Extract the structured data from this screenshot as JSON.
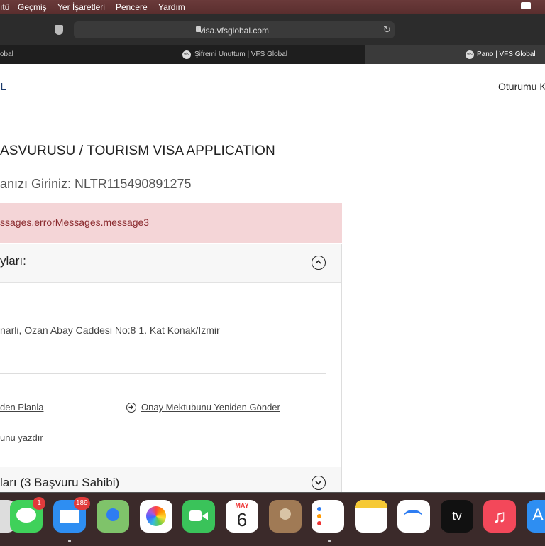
{
  "menubar": {
    "items": [
      "ıtü",
      "Geçmiş",
      "Yer İşaretleri",
      "Pencere",
      "Yardım"
    ]
  },
  "toolbar": {
    "url": "visa.vfsglobal.com"
  },
  "tabs": [
    {
      "title": "obal"
    },
    {
      "title": "Şifremi Unuttum | VFS Global"
    },
    {
      "title": "Pano | VFS Global"
    }
  ],
  "site": {
    "logo_fragment": "L",
    "logout_label": "Oturumu K"
  },
  "main": {
    "heading": "ASVURUSU / TOURISM VISA APPLICATION",
    "reference": "anızı Giriniz: NLTR115490891275",
    "error_message": "ssages.errorMessages.message3",
    "card1": {
      "title": "yları:",
      "address": "narli, Ozan Abay Caddesi No:8 1. Kat Konak/Izmir",
      "links": {
        "reschedule": "den Planla",
        "resend": "Onay Mektubunu Yeniden Gönder",
        "print": "unu yazdır"
      }
    },
    "card2": {
      "title": "ları (3 Başvuru Sahibi)"
    }
  },
  "dock": {
    "messages_badge": "1",
    "mail_badge": "189",
    "calendar_month": "MAY",
    "calendar_day": "6",
    "tv_label": "tv"
  }
}
